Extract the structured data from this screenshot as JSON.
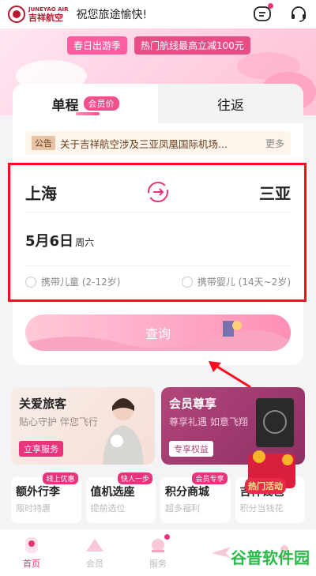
{
  "header": {
    "logo_en": "JUNEYAO AIR",
    "logo_cn": "吉祥航空",
    "greeting": "祝您旅途愉快!"
  },
  "banner": {
    "tag_left": "春日出游季",
    "tag_right": "热门航线最高立减100元"
  },
  "booking": {
    "tabs": [
      {
        "label": "单程",
        "badge": "会员价"
      },
      {
        "label": "往返"
      }
    ],
    "notice": {
      "tag": "公告",
      "text": "关于吉祥航空涉及三亚凤凰国际机场...",
      "more": "更多"
    },
    "from_city": "上海",
    "to_city": "三亚",
    "date": "5月6日",
    "weekday": "周六",
    "option_child": "携带儿童 (2-12岁)",
    "option_infant": "携带婴儿 (14天~2岁)",
    "search_label": "查询"
  },
  "promos": [
    {
      "title": "关爱旅客",
      "sub": "贴心守护 伴您飞行",
      "btn": "立享服务"
    },
    {
      "title": "会员尊享",
      "sub": "尊享礼遇 如意飞翔",
      "btn": "专享权益"
    }
  ],
  "services": [
    {
      "title": "额外行李",
      "sub": "限时特惠",
      "badge": "线上优惠"
    },
    {
      "title": "值机选座",
      "sub": "提前选位",
      "badge": "快人一步"
    },
    {
      "title": "积分商城",
      "sub": "超多福利",
      "badge": "会员专享"
    },
    {
      "title": "吉祥钱包",
      "sub": "积分当钱花"
    }
  ],
  "hot_event": "热门活动",
  "nav": [
    {
      "label": "首页",
      "active": true
    },
    {
      "label": "会员"
    },
    {
      "label": "服务"
    },
    {
      "label": ""
    },
    {
      "label": ""
    }
  ],
  "watermark": "谷普软件园",
  "colors": {
    "accent": "#e8347a",
    "highlight_box": "#ff0a1e"
  }
}
